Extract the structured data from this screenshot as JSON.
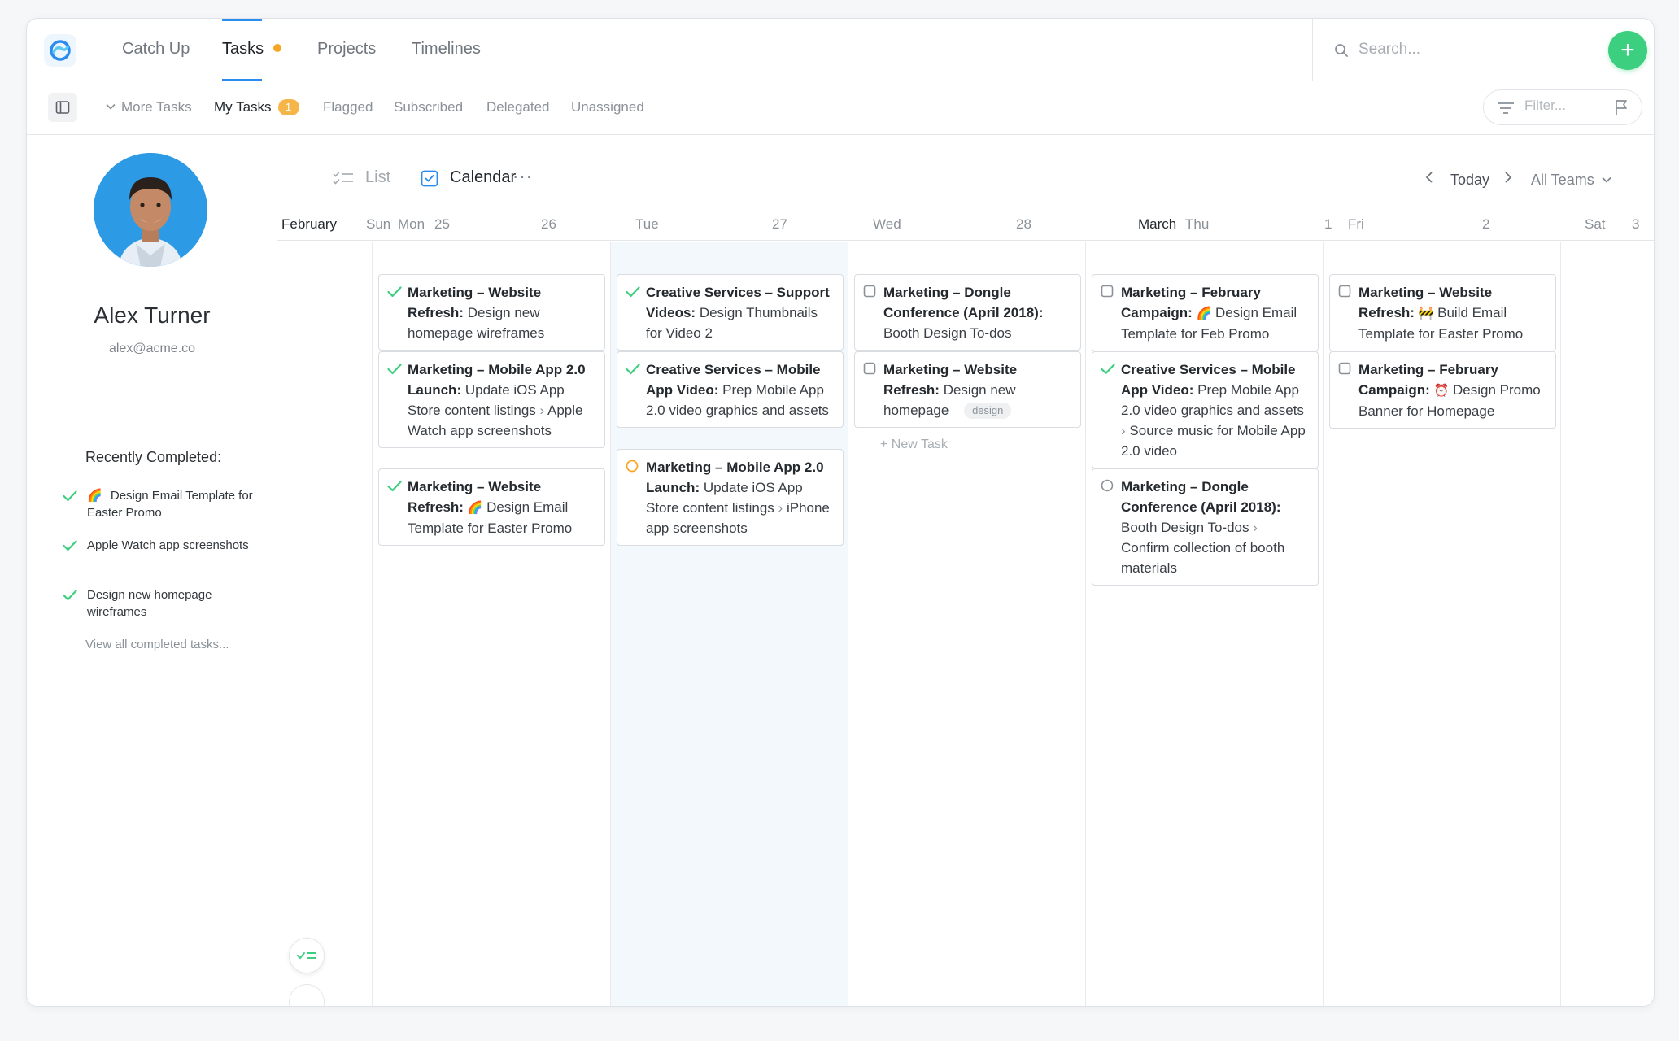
{
  "nav": {
    "tabs": [
      {
        "label": "Catch Up"
      },
      {
        "label": "Tasks"
      },
      {
        "label": "Projects"
      },
      {
        "label": "Timelines"
      }
    ],
    "search_placeholder": "Search..."
  },
  "subnav": {
    "more_tasks": "More Tasks",
    "my_tasks": "My Tasks",
    "my_tasks_count": "1",
    "flagged": "Flagged",
    "subscribed": "Subscribed",
    "delegated": "Delegated",
    "unassigned": "Unassigned",
    "filter_placeholder": "Filter..."
  },
  "profile": {
    "name": "Alex Turner",
    "email": "alex@acme.co",
    "recent_title": "Recently Completed:",
    "recent": [
      {
        "emoji": "🌈",
        "text": "Design Email Template for Easter Promo"
      },
      {
        "text": "Apple Watch app screenshots"
      },
      {
        "text": "Design new homepage wireframes"
      }
    ],
    "view_all": "View all completed tasks..."
  },
  "view": {
    "list_label": "List",
    "calendar_label": "Calendar",
    "more": "···",
    "today": "Today",
    "teams": "All Teams"
  },
  "calendar": {
    "headers": {
      "feb_month": "February",
      "sun": "Sun",
      "mon": "Mon",
      "mon_date": "25",
      "tue_prev_date": "26",
      "tue": "Tue",
      "tue_date": "27",
      "wed": "Wed",
      "wed_date": "28",
      "mar_month": "March",
      "thu": "Thu",
      "thu_date": "1",
      "fri": "Fri",
      "fri_date": "2",
      "sat": "Sat",
      "sat_date": "3"
    },
    "cards": {
      "c1": {
        "project": "Marketing – Website Refresh:",
        "task": "Design new homepage wireframes"
      },
      "c2": {
        "project": "Marketing – Mobile App 2.0 Launch:",
        "task": "Update iOS App Store content listings",
        "sub": "Apple Watch app screenshots"
      },
      "c3": {
        "project": "Marketing – Website Refresh:",
        "emoji": "🌈",
        "task": "Design Email Template for Easter Promo"
      },
      "c4": {
        "project": "Creative Services – Support Videos:",
        "task": "Design Thumbnails for Video 2"
      },
      "c5": {
        "project": "Creative Services – Mobile App Video:",
        "task": "Prep Mobile App 2.0 video graphics and assets"
      },
      "c6": {
        "project": "Marketing – Mobile App 2.0 Launch:",
        "task": "Update iOS App Store content listings",
        "sub": "iPhone app screenshots"
      },
      "c7": {
        "project": "Marketing – Dongle Conference (April 2018):",
        "task": "Booth Design To-dos"
      },
      "c8": {
        "project": "Marketing – Website Refresh:",
        "task": "Design new homepage",
        "tag": "design"
      },
      "c9": {
        "project": "Marketing – February Campaign:",
        "emoji": "🌈",
        "task": "Design Email Template for Feb Promo"
      },
      "c10": {
        "project": "Creative Services – Mobile App Video:",
        "task": "Prep Mobile App 2.0 video graphics and assets",
        "sub": "Source music for Mobile App 2.0 video"
      },
      "c11": {
        "project": "Marketing – Dongle Conference (April 2018):",
        "task": "Booth Design To-dos",
        "sub": "Confirm collection of booth materials"
      },
      "c12": {
        "project": "Marketing – Website Refresh:",
        "emoji": "🚧",
        "task": "Build Email Template for Easter Promo"
      },
      "c13": {
        "project": "Marketing – February Campaign:",
        "emoji": "⏰",
        "task": "Design Promo Banner for Homepage"
      }
    },
    "new_task": "+ New Task"
  },
  "colors": {
    "accent": "#2a8cf0",
    "add_button": "#3ccf7f",
    "check_green": "#3ccf7f",
    "in_progress": "#f5a623",
    "badge": "#f5b547"
  }
}
